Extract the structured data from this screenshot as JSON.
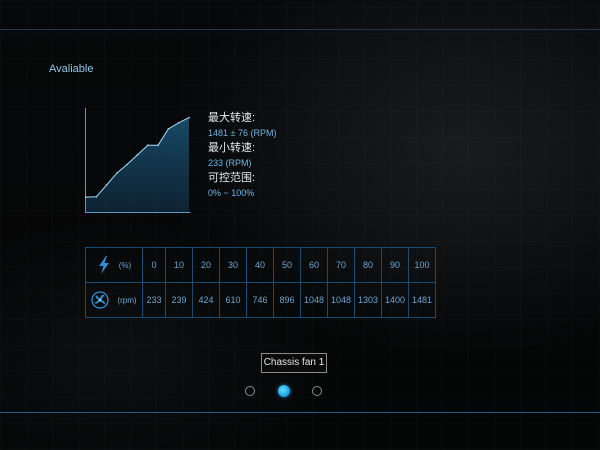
{
  "status": {
    "text": "Avaliable"
  },
  "specs": {
    "max_label": "最大转速:",
    "max_value": "1481 ± 76 (RPM)",
    "min_label": "最小转速:",
    "min_value": "233 (RPM)",
    "range_label": "可控范围:",
    "range_value": "0% ~ 100%"
  },
  "table": {
    "percent_unit": "(%)",
    "rpm_unit": "(rpm)",
    "percent_icon": "lightning-icon",
    "rpm_icon": "fan-icon",
    "percents": [
      "0",
      "10",
      "20",
      "30",
      "40",
      "50",
      "60",
      "70",
      "80",
      "90",
      "100"
    ],
    "rpms": [
      "233",
      "239",
      "424",
      "610",
      "746",
      "896",
      "1048",
      "1048",
      "1303",
      "1400",
      "1481"
    ]
  },
  "chart_data": {
    "type": "area",
    "x": [
      0,
      10,
      20,
      30,
      40,
      50,
      60,
      70,
      80,
      90,
      100
    ],
    "y": [
      233,
      239,
      424,
      610,
      746,
      896,
      1048,
      1048,
      1303,
      1400,
      1481
    ],
    "ylim": [
      0,
      1600
    ],
    "grid": false,
    "color": "#8fd0f5"
  },
  "fan_selector": {
    "label": "Chassis fan 1",
    "page_count": 3,
    "active_index": 1
  },
  "colors": {
    "accent": "#1aa6e8",
    "table_border": "#1b4b70",
    "text_blue": "#6aa6d4"
  }
}
